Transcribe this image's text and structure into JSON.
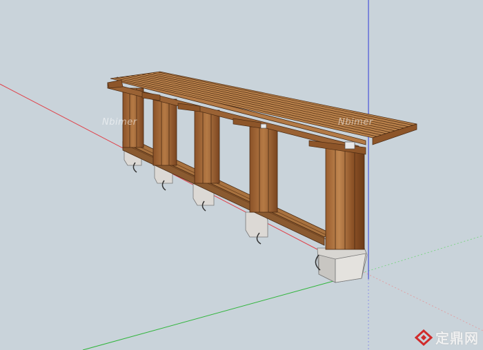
{
  "image": {
    "subject": "3D model of a timber pergola with attached benches on stone plinths",
    "colors": {
      "background": "#c9d3da",
      "wood_light": "#a9703e",
      "wood_dark": "#6b3f1d",
      "stone": "#d9d6d2",
      "axis_red": "#e0424a",
      "axis_green": "#2fb53a",
      "axis_blue": "#3038d8"
    }
  },
  "watermarks": {
    "left": "Nbimer",
    "right": "Nbimer"
  },
  "logo": {
    "icon": "zhulong-logo-icon",
    "text": "定鼎网"
  }
}
